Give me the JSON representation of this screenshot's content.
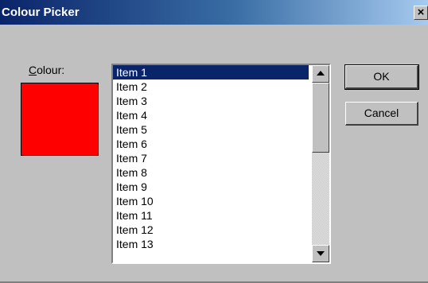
{
  "window": {
    "title": "Colour Picker",
    "close_glyph": "✕"
  },
  "colour": {
    "label_accel": "C",
    "label_rest": "olour:",
    "swatch_color": "#ff0000"
  },
  "list": {
    "selected_index": 0,
    "items": [
      "Item 1",
      "Item 2",
      "Item 3",
      "Item 4",
      "Item 5",
      "Item 6",
      "Item 7",
      "Item 8",
      "Item 9",
      "Item 10",
      "Item 11",
      "Item 12",
      "Item 13"
    ]
  },
  "buttons": {
    "ok_label": "OK",
    "cancel_label": "Cancel"
  },
  "colors": {
    "title_bar": "#0a246a",
    "selection": "#0a246a",
    "dialog_face": "#c0c0c0"
  }
}
